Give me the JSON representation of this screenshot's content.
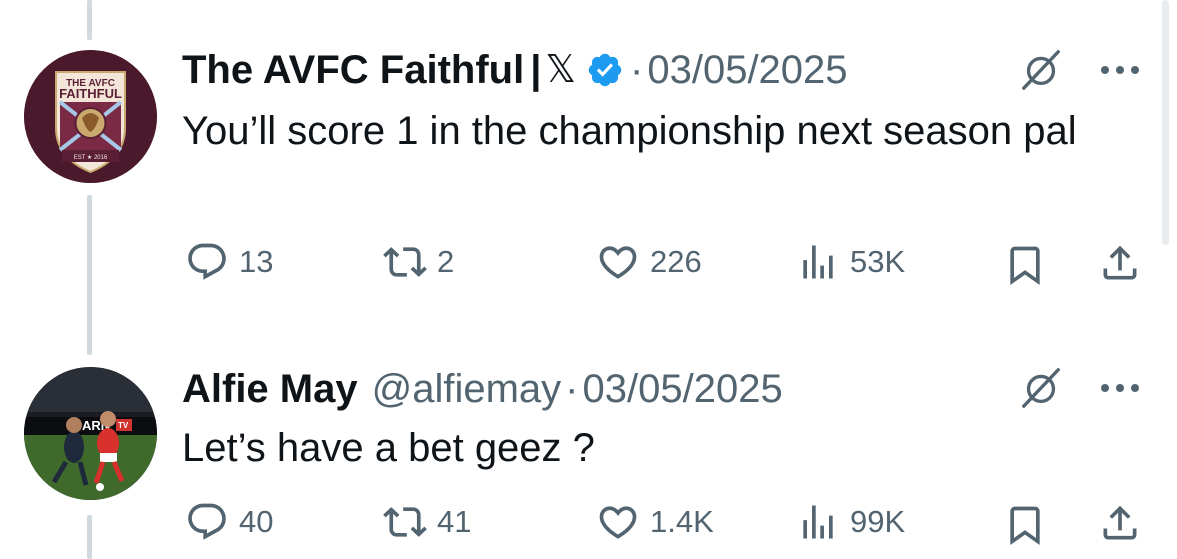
{
  "tweets": [
    {
      "display_name": "The AVFC Faithful",
      "name_suffix": "|",
      "x_mark": "𝕏",
      "verified": true,
      "handle": "",
      "separator": "·",
      "date": "03/05/2025",
      "text": "You’ll score 1 in the championship next season pal",
      "avatar": {
        "type": "crest",
        "line1": "THE AVFC",
        "line2": "FAITHFUL",
        "bg_color": "#4a1a2c",
        "accent_color": "#a8c8e8"
      },
      "stats": {
        "replies": "13",
        "reposts": "2",
        "likes": "226",
        "views": "53K"
      }
    },
    {
      "display_name": "Alfie May",
      "name_suffix": "",
      "x_mark": "",
      "verified": false,
      "handle": "@alfiemay",
      "separator": "·",
      "date": "03/05/2025",
      "text": "Let’s have a bet geez ?",
      "avatar": {
        "type": "photo",
        "description": "footballer in red kit running on pitch",
        "board_text": "ARN",
        "board_badge": "TV"
      },
      "stats": {
        "replies": "40",
        "reposts": "41",
        "likes": "1.4K",
        "views": "99K"
      }
    }
  ],
  "icons": {
    "grok": "grok-icon",
    "more": "more-icon",
    "reply": "reply-icon",
    "repost": "repost-icon",
    "like": "heart-icon",
    "views": "views-icon",
    "bookmark": "bookmark-icon",
    "share": "share-icon"
  },
  "colors": {
    "text_primary": "#0f1419",
    "text_secondary": "#536471",
    "verified_blue": "#1d9bf0",
    "thread_line": "#cfd9de"
  }
}
